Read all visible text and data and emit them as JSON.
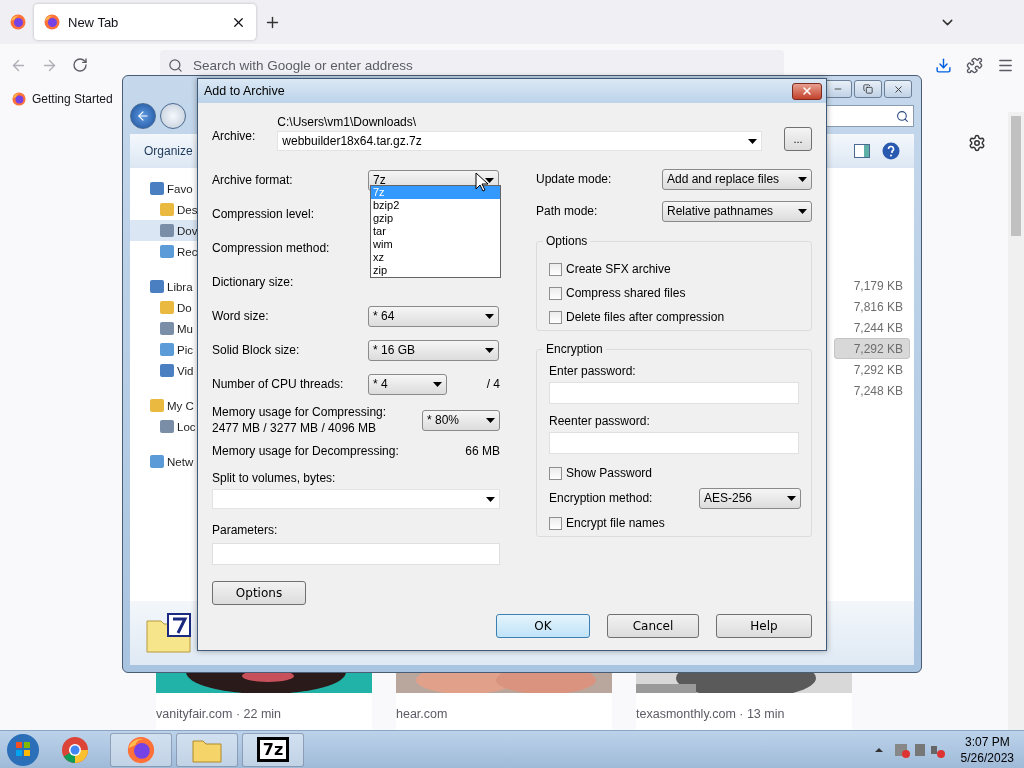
{
  "browser": {
    "tabs": [
      {
        "label": "New Tab",
        "selected": true
      }
    ],
    "address": {
      "placeholder": "Search with Google or enter address"
    },
    "bookmarks": [
      {
        "label": "Getting Started"
      }
    ],
    "stories": [
      {
        "caption": "vanityfair.com · 22 min"
      },
      {
        "caption": "hear.com"
      },
      {
        "caption": "texasmonthly.com · 13 min"
      }
    ]
  },
  "explorer": {
    "toolbar": {
      "organize": "Organize"
    },
    "nav": [
      {
        "label": "Favo",
        "selected": false,
        "children": [
          {
            "label": "Des",
            "selected": false
          },
          {
            "label": "Dov",
            "selected": true
          },
          {
            "label": "Rec",
            "selected": false
          }
        ]
      },
      {
        "label": "Libra",
        "selected": false,
        "children": [
          {
            "label": "Do",
            "selected": false
          },
          {
            "label": "Mu",
            "selected": false
          },
          {
            "label": "Pic",
            "selected": false
          },
          {
            "label": "Vid",
            "selected": false
          }
        ]
      },
      {
        "label": "My C",
        "selected": false,
        "children": [
          {
            "label": "Loc",
            "selected": false
          }
        ]
      },
      {
        "label": "Netw",
        "selected": false
      }
    ],
    "sizes": [
      {
        "text": "7,179 KB",
        "selected": false
      },
      {
        "text": "7,816 KB",
        "selected": false
      },
      {
        "text": "7,244 KB",
        "selected": false
      },
      {
        "text": "7,292 KB",
        "selected": true
      },
      {
        "text": "7,292 KB",
        "selected": false
      },
      {
        "text": "7,248 KB",
        "selected": false
      }
    ]
  },
  "dialog": {
    "title": "Add to Archive",
    "archive_label": "Archive:",
    "archive_path": "C:\\Users\\vm1\\Downloads\\",
    "archive_name": "webbuilder18x64.tar.gz.7z",
    "browse": "...",
    "left_rows": [
      {
        "kind": "format",
        "label": "Archive format:",
        "value": "7z"
      },
      {
        "kind": "covered",
        "label": "Compression level:"
      },
      {
        "kind": "covered",
        "label": "Compression method:"
      },
      {
        "kind": "covered",
        "label": "Dictionary size:"
      },
      {
        "kind": "combo",
        "label": "Word size:",
        "value": "* 64"
      },
      {
        "kind": "combo",
        "label": "Solid Block size:",
        "value": "* 16 GB"
      },
      {
        "kind": "threads",
        "label": "Number of CPU threads:",
        "value": "* 4",
        "suffix": "/ 4"
      },
      {
        "kind": "memory",
        "label": "Memory usage for Compressing:",
        "detail": "2477 MB / 3277 MB / 4096 MB",
        "value": "* 80%"
      },
      {
        "kind": "reading",
        "label": "Memory usage for Decompressing:",
        "value": "66 MB"
      }
    ],
    "format_options": [
      {
        "label": "7z",
        "selected": true
      },
      {
        "label": "bzip2",
        "selected": false
      },
      {
        "label": "gzip",
        "selected": false
      },
      {
        "label": "tar",
        "selected": false
      },
      {
        "label": "wim",
        "selected": false
      },
      {
        "label": "xz",
        "selected": false
      },
      {
        "label": "zip",
        "selected": false
      }
    ],
    "split_label": "Split to volumes, bytes:",
    "parameters_label": "Parameters:",
    "options_button": "Options",
    "update_mode": {
      "label": "Update mode:",
      "value": "Add and replace files"
    },
    "path_mode": {
      "label": "Path mode:",
      "value": "Relative pathnames"
    },
    "options_group": {
      "title": "Options",
      "checks": [
        {
          "label": "Create SFX archive",
          "checked": false
        },
        {
          "label": "Compress shared files",
          "checked": false
        },
        {
          "label": "Delete files after compression",
          "checked": false
        }
      ]
    },
    "encryption": {
      "title": "Encryption",
      "enter_label": "Enter password:",
      "reenter_label": "Reenter password:",
      "show_password": {
        "label": "Show Password",
        "checked": false
      },
      "method_label": "Encryption method:",
      "method": "AES-256",
      "encrypt_names": {
        "label": "Encrypt file names",
        "checked": false
      }
    },
    "buttons": [
      {
        "label": "OK",
        "default": true
      },
      {
        "label": "Cancel",
        "default": false
      },
      {
        "label": "Help",
        "default": false
      }
    ]
  },
  "taskbar": {
    "apps": [
      {
        "kind": "chrome"
      },
      {
        "kind": "firefox"
      },
      {
        "kind": "folder"
      },
      {
        "kind": "archiver",
        "label": "7z"
      }
    ],
    "time": "3:07 PM",
    "date": "5/26/2023"
  }
}
